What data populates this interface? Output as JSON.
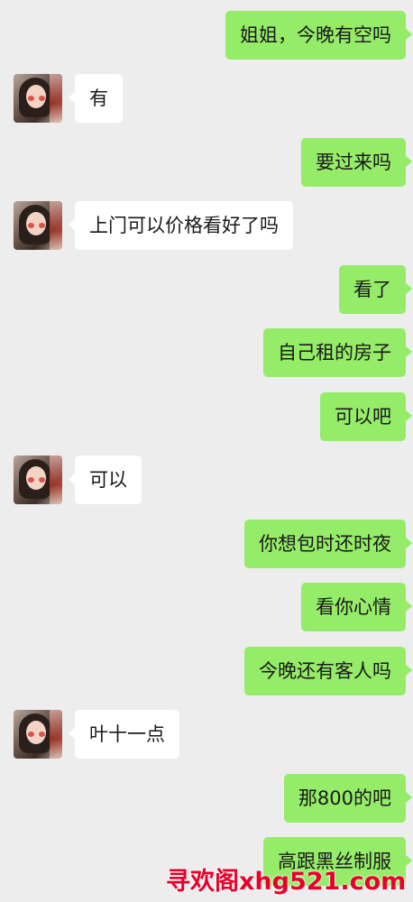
{
  "messages": [
    {
      "side": "me",
      "text": "姐姐，今晚有空吗"
    },
    {
      "side": "other",
      "text": "有"
    },
    {
      "side": "me",
      "text": "要过来吗"
    },
    {
      "side": "other",
      "text": "上门可以价格看好了吗"
    },
    {
      "side": "me",
      "text": "看了"
    },
    {
      "side": "me",
      "text": "自己租的房子"
    },
    {
      "side": "me",
      "text": "可以吧"
    },
    {
      "side": "other",
      "text": "可以"
    },
    {
      "side": "me",
      "text": "你想包时还时夜"
    },
    {
      "side": "me",
      "text": "看你心情"
    },
    {
      "side": "me",
      "text": "今晚还有客人吗"
    },
    {
      "side": "other",
      "text": "叶十一点"
    },
    {
      "side": "me",
      "text": "那800的吧"
    },
    {
      "side": "me",
      "text": "高跟黑丝制服"
    }
  ],
  "watermark": "寻欢阁xhg521.com",
  "colors": {
    "background": "#ededed",
    "my_bubble": "#95ec69",
    "their_bubble": "#ffffff",
    "watermark": "#e8002a"
  }
}
